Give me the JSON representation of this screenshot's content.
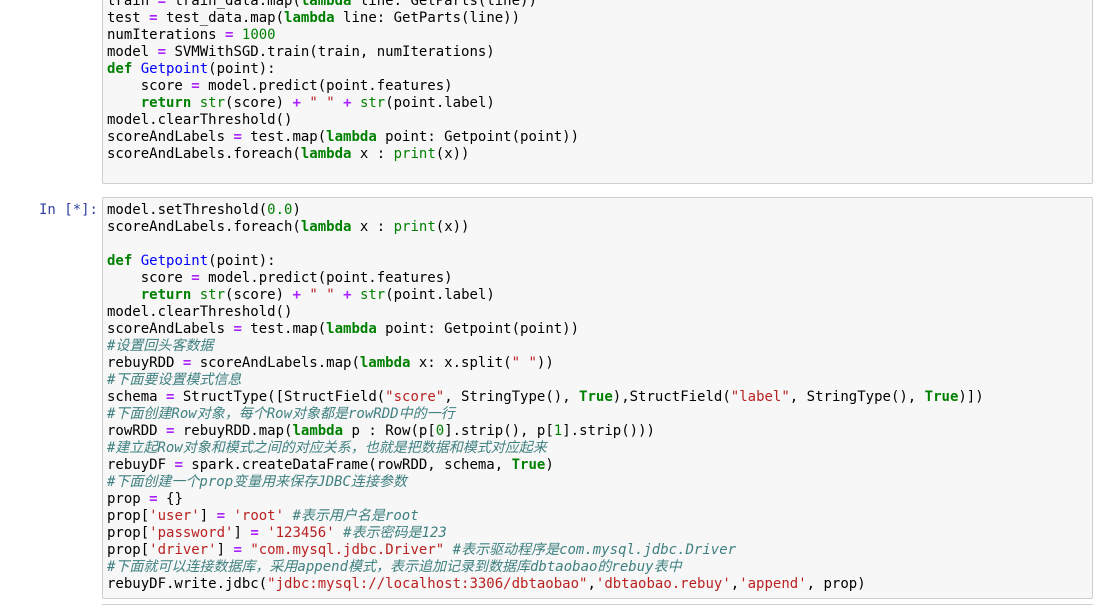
{
  "cell1": {
    "lines": [
      "train = train_data.map(lambda line: GetParts(line))",
      "test = test_data.map(lambda line: GetParts(line))",
      "numIterations = 1000",
      "model = SVMWithSGD.train(train, numIterations)",
      "def Getpoint(point):",
      "    score = model.predict(point.features)",
      "    return str(score) + \" \" + str(point.label)",
      "model.clearThreshold()",
      "scoreAndLabels = test.map(lambda point: Getpoint(point))",
      "scoreAndLabels.foreach(lambda x : print(x))"
    ]
  },
  "cell2": {
    "prompt": "In [*]:",
    "lines": [
      "model.setThreshold(0.0)",
      "scoreAndLabels.foreach(lambda x : print(x))",
      "",
      "def Getpoint(point):",
      "    score = model.predict(point.features)",
      "    return str(score) + \" \" + str(point.label)",
      "model.clearThreshold()",
      "scoreAndLabels = test.map(lambda point: Getpoint(point))",
      "#设置回头客数据",
      "rebuyRDD = scoreAndLabels.map(lambda x: x.split(\" \"))",
      "#下面要设置模式信息",
      "schema = StructType([StructField(\"score\", StringType(), True),StructField(\"label\", StringType(), True)])",
      "#下面创建Row对象，每个Row对象都是rowRDD中的一行",
      "rowRDD = rebuyRDD.map(lambda p : Row(p[0].strip(), p[1].strip()))",
      "#建立起Row对象和模式之间的对应关系，也就是把数据和模式对应起来",
      "rebuyDF = spark.createDataFrame(rowRDD, schema, True)",
      "#下面创建一个prop变量用来保存JDBC连接参数",
      "prop = {}",
      "prop['user'] = 'root' #表示用户名是root",
      "prop['password'] = '123456' #表示密码是123",
      "prop['driver'] = \"com.mysql.jdbc.Driver\" #表示驱动程序是com.mysql.jdbc.Driver",
      "#下面就可以连接数据库，采用append模式，表示追加记录到数据库dbtaobao的rebuy表中",
      "rebuyDF.write.jdbc(\"jdbc:mysql://localhost:3306/dbtaobao\",'dbtaobao.rebuy','append', prop)"
    ]
  },
  "colors": {
    "keyword": "#008000",
    "operator": "#AA22FF",
    "string": "#BA2121",
    "comment": "#408080",
    "function_name": "#0000FF",
    "prompt": "#303F9F",
    "cell_background": "#f7f7f7",
    "cell_border": "#cfcfcf"
  }
}
